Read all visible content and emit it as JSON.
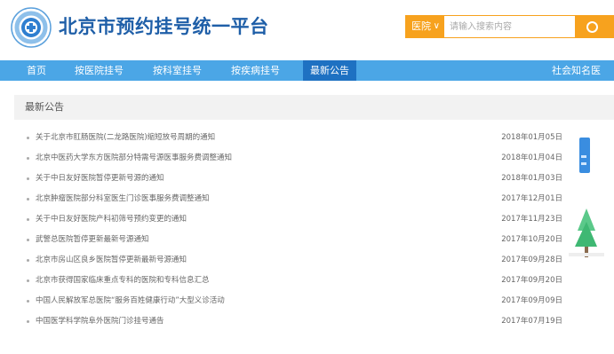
{
  "header": {
    "site_title": "北京市预约挂号统一平台",
    "search": {
      "select_value": "医院",
      "placeholder": "请输入搜索内容"
    }
  },
  "nav": {
    "items": [
      {
        "label": "首页"
      },
      {
        "label": "按医院挂号"
      },
      {
        "label": "按科室挂号"
      },
      {
        "label": "按疾病挂号"
      },
      {
        "label": "最新公告",
        "active": true
      }
    ],
    "right_label": "社会知名医"
  },
  "panel": {
    "title": "最新公告"
  },
  "notices": [
    {
      "title": "关于北京市肛肠医院(二龙路医院)缩短放号周期的通知",
      "date": "2018年01月05日"
    },
    {
      "title": "北京中医药大学东方医院部分特需号源医事服务费调整通知",
      "date": "2018年01月04日"
    },
    {
      "title": "关于中日友好医院暂停更新号源的通知",
      "date": "2018年01月03日"
    },
    {
      "title": "北京肿瘤医院部分科室医生门诊医事服务费调整通知",
      "date": "2017年12月01日"
    },
    {
      "title": "关于中日友好医院产科初筛号预约变更的通知",
      "date": "2017年11月23日"
    },
    {
      "title": "武警总医院暂停更新最新号源通知",
      "date": "2017年10月20日"
    },
    {
      "title": "北京市房山区良乡医院暂停更新最新号源通知",
      "date": "2017年09月28日"
    },
    {
      "title": "北京市获得国家临床重点专科的医院和专科信息汇总",
      "date": "2017年09月20日"
    },
    {
      "title": "中国人民解放军总医院“服务百姓健康行动”大型义诊活动",
      "date": "2017年09月09日"
    },
    {
      "title": "中国医学科学院阜外医院门诊挂号通告",
      "date": "2017年07月19日"
    }
  ],
  "colors": {
    "brand_blue": "#1f5fa8",
    "nav_bg": "#4ba6e6",
    "nav_active": "#1e71c2",
    "search_orange": "#f7a21e"
  }
}
